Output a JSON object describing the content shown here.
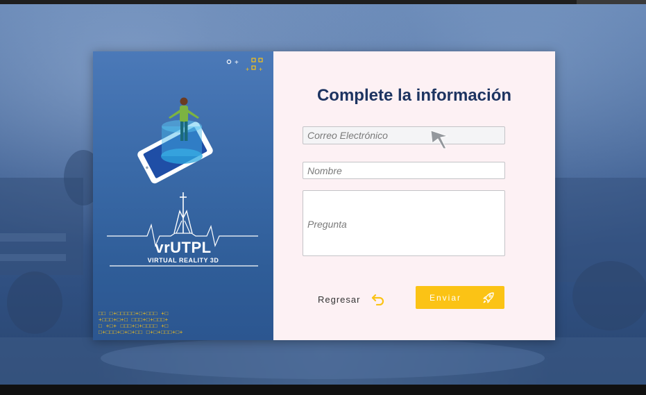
{
  "form": {
    "title": "Complete la información",
    "email_placeholder": "Correo Electrónico",
    "name_placeholder": "Nombre",
    "question_placeholder": "Pregunta",
    "back_label": "Regresar",
    "send_label": "Enviar"
  },
  "brand": {
    "logo_text": "vrUTPL",
    "logo_subtitle": "VIRTUAL REALITY 3D"
  },
  "colors": {
    "title": "#1d3461",
    "accent_yellow": "#fbc315",
    "panel_blue": "#3a6aa8",
    "form_bg": "#fdf1f4"
  },
  "icons": {
    "back": "undo-arrow-icon",
    "send": "rocket-icon"
  }
}
